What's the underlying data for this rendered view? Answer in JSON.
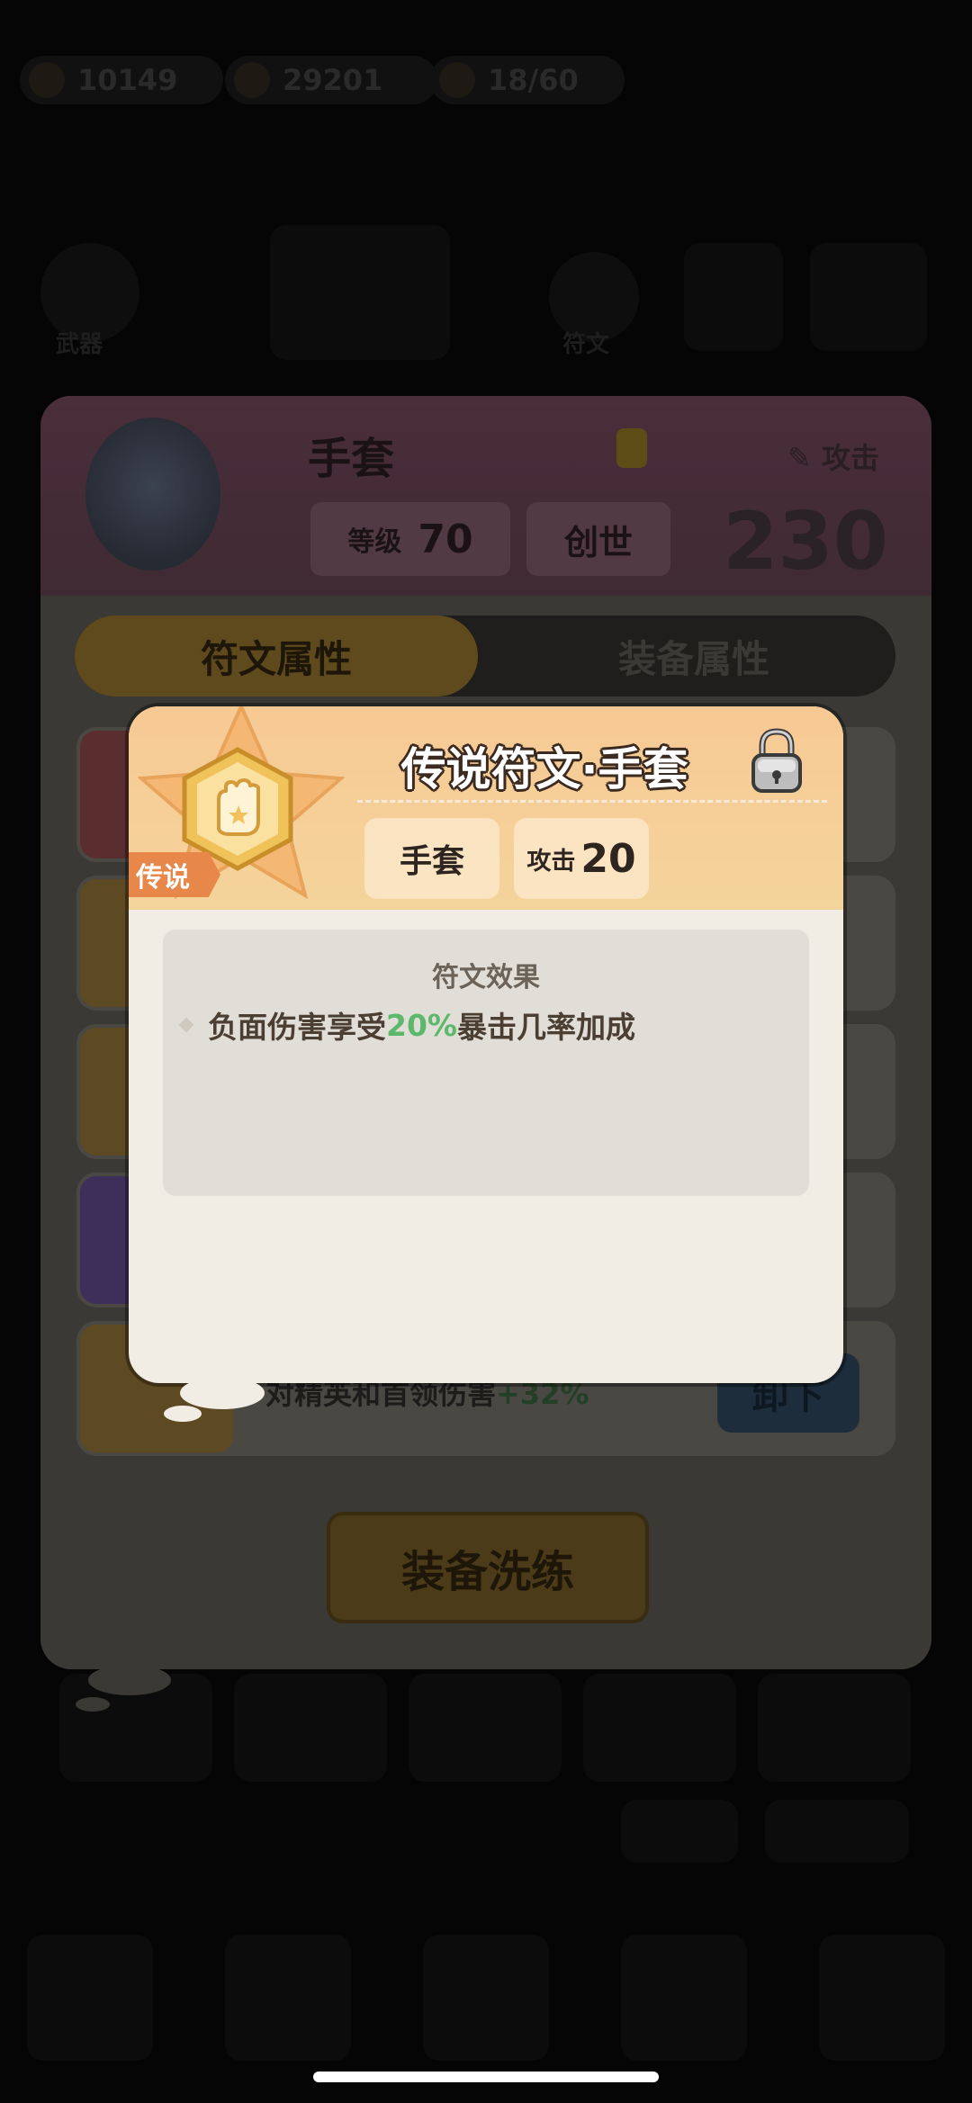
{
  "background": {
    "resources": [
      {
        "icon": "gem-icon",
        "value": "10149"
      },
      {
        "icon": "coin-icon",
        "value": "29201"
      },
      {
        "icon": "stamina-icon",
        "value": "18/60"
      }
    ],
    "nav_labels": [
      "武器",
      "符文"
    ]
  },
  "panel": {
    "item_name": "手套",
    "stat_label": "攻击",
    "level_label": "等级",
    "level_value": "70",
    "tier": "创世",
    "power": "230",
    "tabs": {
      "rune": "符文属性",
      "equip": "装备属性"
    },
    "last_row": {
      "text_prefix": "对精英和首领伤害",
      "text_value": "+32%",
      "button": "卸下"
    },
    "reforge_button": "装备洗练"
  },
  "modal": {
    "title": "传说符文·手套",
    "rarity_tag": "传说",
    "slot_chip": "手套",
    "stat_label": "攻击",
    "stat_value": "20",
    "effect_title": "符文效果",
    "effect": {
      "prefix": "负面伤害享受",
      "value": "20%",
      "suffix": "暴击几率加成"
    },
    "colors": {
      "header": "#f7c994",
      "highlight": "#5cb86a",
      "tag": "#e8874a"
    }
  }
}
